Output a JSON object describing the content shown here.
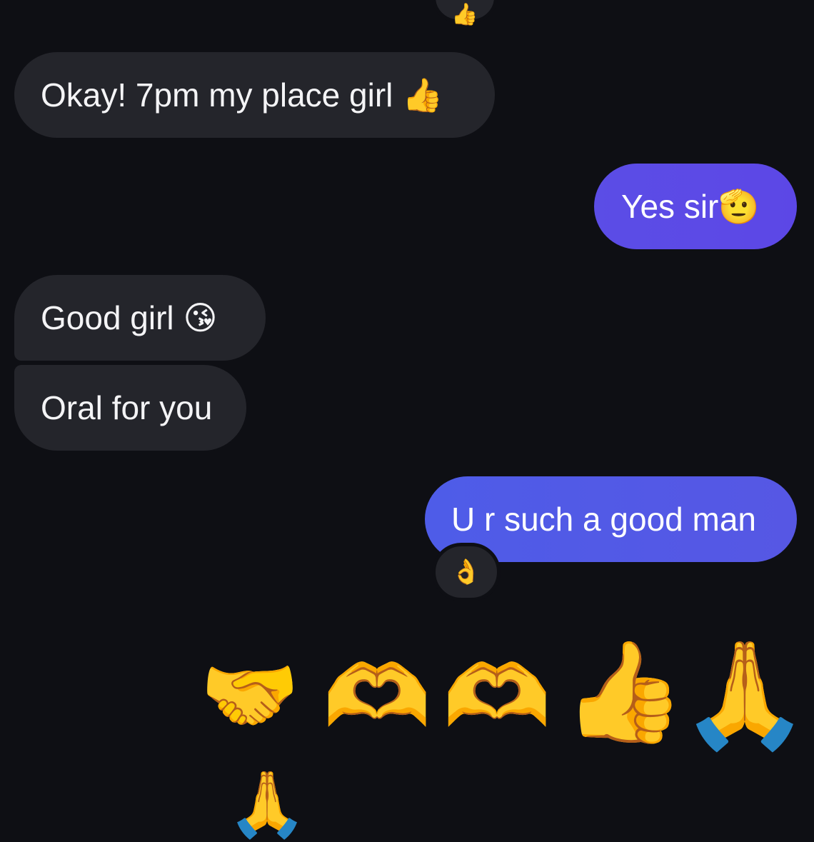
{
  "messages": [
    {
      "text": "Okay! 7pm my place girl",
      "emoji": "👍",
      "from": "them"
    },
    {
      "text": "Yes sir",
      "emoji": "🫡",
      "from": "me"
    },
    {
      "text": "Good girl",
      "emoji": "😘",
      "from": "them"
    },
    {
      "text": "Oral for you",
      "emoji": "",
      "from": "them"
    },
    {
      "text": "U r such a good man",
      "emoji": "",
      "from": "me"
    }
  ],
  "reactions": {
    "top_partial": "👍",
    "on_good_man": "👌"
  },
  "emoji_row": [
    "🤝",
    "🫶",
    "🫶",
    "👍",
    "🙏"
  ],
  "emoji_next": "🙏",
  "colors": {
    "background": "#0e0f14",
    "incoming_bubble": "#24252b",
    "outgoing_bubble": "#5b4de6",
    "text": "#f4f4f6"
  }
}
